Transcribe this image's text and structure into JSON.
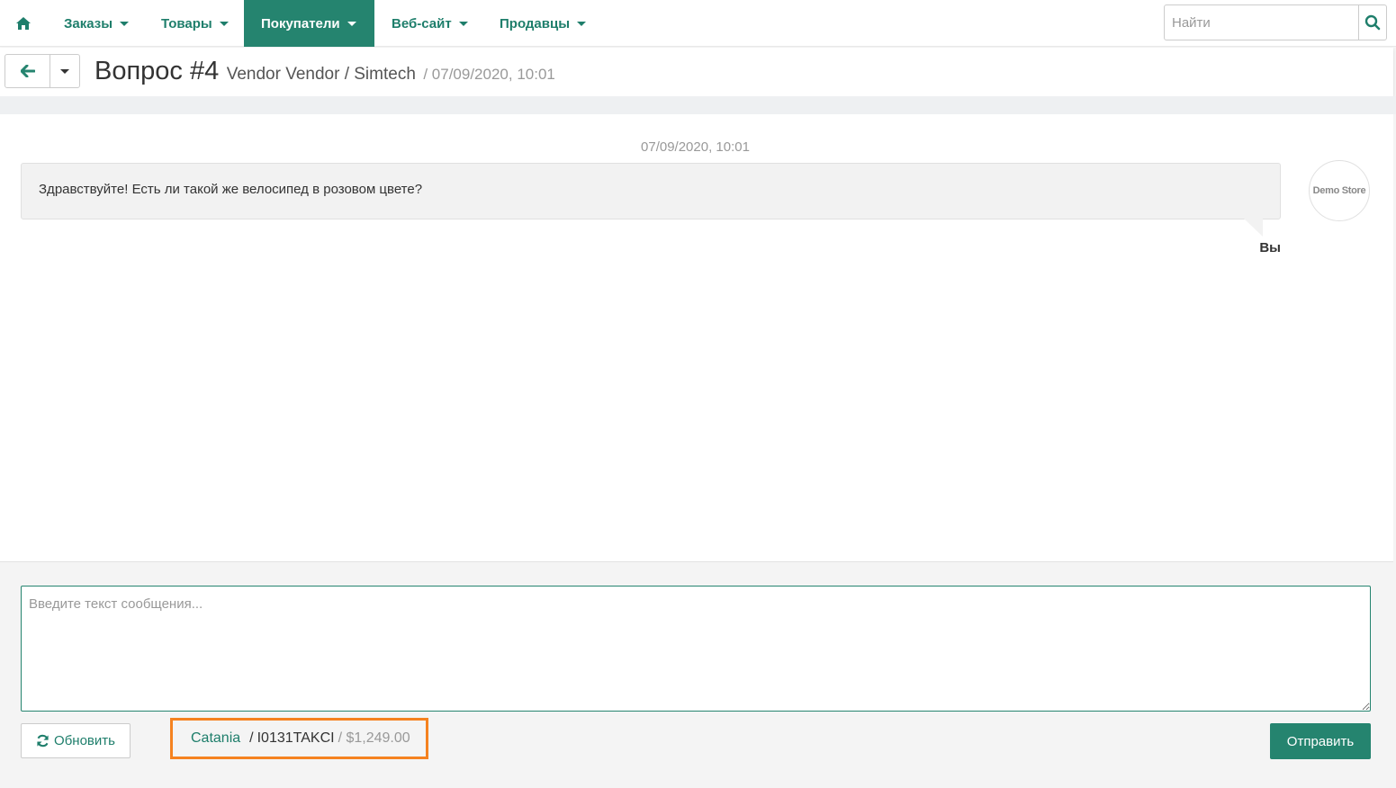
{
  "nav": {
    "home_icon": "home-icon",
    "items": [
      {
        "label": "Заказы"
      },
      {
        "label": "Товары"
      },
      {
        "label": "Покупатели",
        "active": true
      },
      {
        "label": "Веб-сайт"
      },
      {
        "label": "Продавцы"
      }
    ],
    "search": {
      "placeholder": "Найти",
      "icon": "search-icon"
    }
  },
  "header": {
    "title": "Вопрос #4",
    "subtitle": "Vendor Vendor / Simtech",
    "date": "/ 07/09/2020, 10:01"
  },
  "messages": [
    {
      "date": "07/09/2020, 10:01",
      "text": "Здравствуйте! Есть ли такой же велосипед в розовом цвете?",
      "sender": "Вы",
      "avatar_text": "Demo Store"
    }
  ],
  "composer": {
    "placeholder": "Введите текст сообщения...",
    "refresh_label": "Обновить",
    "send_label": "Отправить"
  },
  "product": {
    "name": "Catania",
    "separator": "/",
    "code": "I0131TAKCI",
    "price": "/ $1,249.00"
  },
  "colors": {
    "accent": "#25846f",
    "link": "#1e7e6b",
    "highlight_border": "#f58220"
  }
}
